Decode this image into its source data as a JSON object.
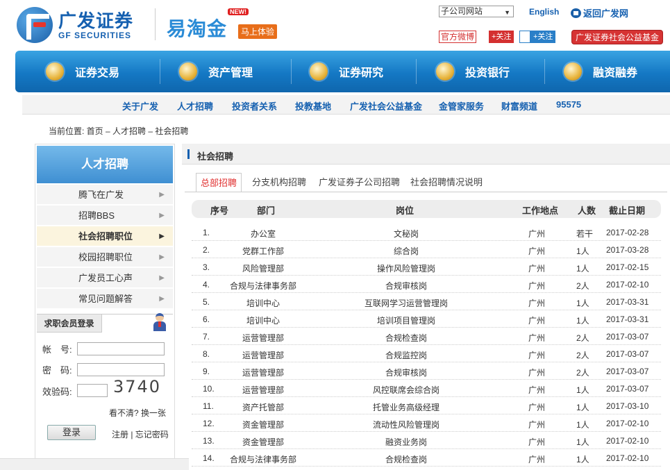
{
  "header": {
    "logo_cn": "广发证券",
    "logo_en": "GF SECURITIES",
    "yitaojin": "易淘金",
    "yitaojin_badge": "NEW!",
    "yitaojin_try": "马上体验",
    "site_select": "子公司网站",
    "english": "English",
    "back_home": "返回广发网",
    "weibo": "官方微博",
    "follow1": "+关注",
    "follow2": "+关注",
    "charity_fund": "广发证券社会公益基金"
  },
  "main_nav": [
    {
      "label": "证券交易",
      "icon": "coins-icon"
    },
    {
      "label": "资产管理",
      "icon": "briefcase-icon"
    },
    {
      "label": "证券研究",
      "icon": "document-icon"
    },
    {
      "label": "投资银行",
      "icon": "bank-icon"
    },
    {
      "label": "融资融券",
      "icon": "moneybag-icon"
    }
  ],
  "sub_nav": [
    "关于广发",
    "人才招聘",
    "投资者关系",
    "投教基地",
    "广发社会公益基金",
    "金管家服务",
    "财富频道",
    "95575"
  ],
  "breadcrumb": "当前位置: 首页 – 人才招聘 – 社会招聘",
  "sidebar": {
    "title": "人才招聘",
    "items": [
      "腾飞在广发",
      "招聘BBS",
      "社会招聘职位",
      "校园招聘职位",
      "广发员工心声",
      "常见问题解答"
    ],
    "active_index": 2,
    "login": {
      "tab": "求职会员登录",
      "account_label": "帐　号:",
      "password_label": "密　码:",
      "captcha_label": "效验码:",
      "captcha_value": "3740",
      "refresh": "看不清? 换一张",
      "login_button": "登录",
      "register_links": "注册 | 忘记密码"
    }
  },
  "content": {
    "title": "社会招聘",
    "tabs": [
      "总部招聘",
      "分支机构招聘",
      "广发证券子公司招聘",
      "社会招聘情况说明"
    ],
    "active_tab": 0,
    "columns": [
      "序号",
      "部门",
      "岗位",
      "工作地点",
      "人数",
      "截止日期"
    ],
    "rows": [
      [
        "1.",
        "办公室",
        "文秘岗",
        "广州",
        "若干",
        "2017-02-28"
      ],
      [
        "2.",
        "党群工作部",
        "综合岗",
        "广州",
        "1人",
        "2017-03-28"
      ],
      [
        "3.",
        "风险管理部",
        "操作风险管理岗",
        "广州",
        "1人",
        "2017-02-15"
      ],
      [
        "4.",
        "合规与法律事务部",
        "合规审核岗",
        "广州",
        "2人",
        "2017-02-10"
      ],
      [
        "5.",
        "培训中心",
        "互联网学习运营管理岗",
        "广州",
        "1人",
        "2017-03-31"
      ],
      [
        "6.",
        "培训中心",
        "培训项目管理岗",
        "广州",
        "1人",
        "2017-03-31"
      ],
      [
        "7.",
        "运营管理部",
        "合规检查岗",
        "广州",
        "2人",
        "2017-03-07"
      ],
      [
        "8.",
        "运营管理部",
        "合规监控岗",
        "广州",
        "2人",
        "2017-03-07"
      ],
      [
        "9.",
        "运营管理部",
        "合规审核岗",
        "广州",
        "2人",
        "2017-03-07"
      ],
      [
        "10.",
        "运营管理部",
        "风控联席会综合岗",
        "广州",
        "1人",
        "2017-03-07"
      ],
      [
        "11.",
        "资产托管部",
        "托管业务高级经理",
        "广州",
        "1人",
        "2017-03-10"
      ],
      [
        "12.",
        "资金管理部",
        "流动性风险管理岗",
        "广州",
        "1人",
        "2017-02-10"
      ],
      [
        "13.",
        "资金管理部",
        "融资业务岗",
        "广州",
        "1人",
        "2017-02-10"
      ],
      [
        "14.",
        "合规与法律事务部",
        "合规检查岗",
        "广州",
        "1人",
        "2017-02-10"
      ]
    ]
  }
}
